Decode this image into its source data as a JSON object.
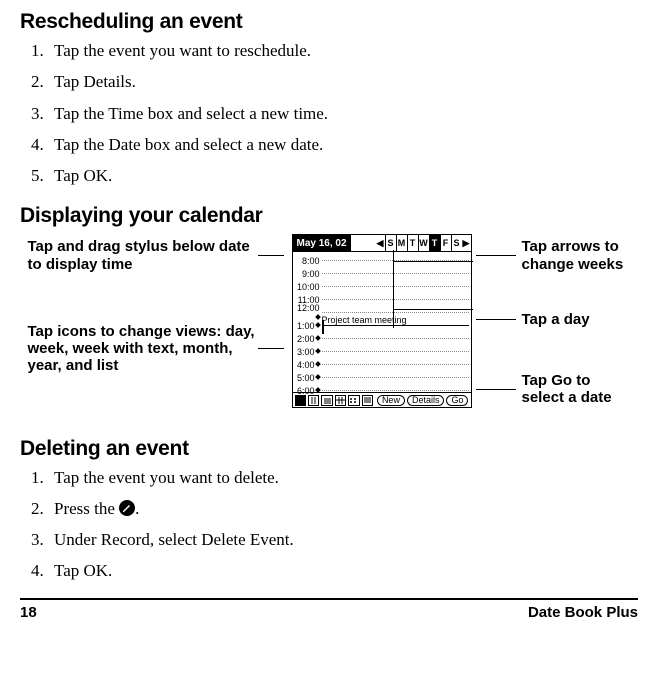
{
  "sections": {
    "rescheduling_title": "Rescheduling an event",
    "displaying_title": "Displaying your calendar",
    "deleting_title": "Deleting an event"
  },
  "reschedule_steps": [
    "Tap the event you want to reschedule.",
    "Tap Details.",
    "Tap the Time box and select a new time.",
    "Tap the Date box and select a new date.",
    "Tap OK."
  ],
  "delete_steps_pre": "Tap the event you want to delete.",
  "delete_steps_press_prefix": "Press the ",
  "delete_steps_press_suffix": ".",
  "delete_steps_3": "Under Record, select Delete Event.",
  "delete_steps_4": "Tap OK.",
  "callouts": {
    "drag_stylus": "Tap and drag stylus below date to display time",
    "change_views": "Tap icons to change views: day, week, week with text, month, year, and list",
    "arrows_weeks": "Tap arrows to change weeks",
    "tap_day": "Tap a day",
    "tap_go": "Tap Go to select a date"
  },
  "pda": {
    "title": "May 16, 02",
    "days": [
      "S",
      "M",
      "T",
      "W",
      "T",
      "F",
      "S"
    ],
    "selected_day_index": 4,
    "times": [
      "8:00",
      "9:00",
      "10:00",
      "11:00",
      "12:00",
      "1:00",
      "2:00",
      "3:00",
      "4:00",
      "5:00",
      "6:00"
    ],
    "pm_start_index": 5,
    "event_row_index": 5,
    "event_text": "Project team meeting",
    "buttons": {
      "new": "New",
      "details": "Details",
      "go": "Go"
    }
  },
  "footer": {
    "page": "18",
    "section": "Date Book Plus"
  }
}
